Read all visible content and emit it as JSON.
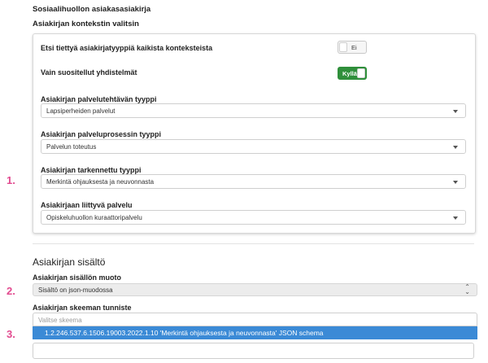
{
  "document": {
    "title": "Sosiaalihuollon asiakasasiakirja",
    "context_title": "Asiakirjan kontekstin valitsin"
  },
  "markers": {
    "m1": "1.",
    "m2": "2.",
    "m3": "3."
  },
  "context_panel": {
    "search_all_label": "Etsi tiettyä asiakirjatyyppiä kaikista konteksteista",
    "search_all_toggle": "Ei",
    "recommended_label": "Vain suositellut yhdistelmät",
    "recommended_toggle": "Kyllä",
    "service_task_label": "Asiakirjan palvelutehtävän tyyppi",
    "service_task_value": "Lapsiperheiden palvelut",
    "service_process_label": "Asiakirjan palveluprosessin tyyppi",
    "service_process_value": "Palvelun toteutus",
    "specified_type_label": "Asiakirjan tarkennettu tyyppi",
    "specified_type_value": "Merkintä ohjauksesta ja neuvonnasta",
    "related_service_label": "Asiakirjaan liittyvä palvelu",
    "related_service_value": "Opiskeluhuollon kuraattoripalvelu"
  },
  "content_section": {
    "title": "Asiakirjan sisältö",
    "format_label": "Asiakirjan sisällön muoto",
    "format_value": "Sisältö on json-muodossa",
    "schema_label": "Asiakirjan skeeman tunniste",
    "schema_placeholder": "Valitse skeema",
    "schema_option": "1.2.246.537.6.1506.19003.2022.1.10 'Merkintä ohjauksesta ja neuvonnasta' JSON schema"
  },
  "colors": {
    "marker": "#e24a8f",
    "toggle_on": "#2f8f3b",
    "highlight": "#3b8ad6"
  }
}
